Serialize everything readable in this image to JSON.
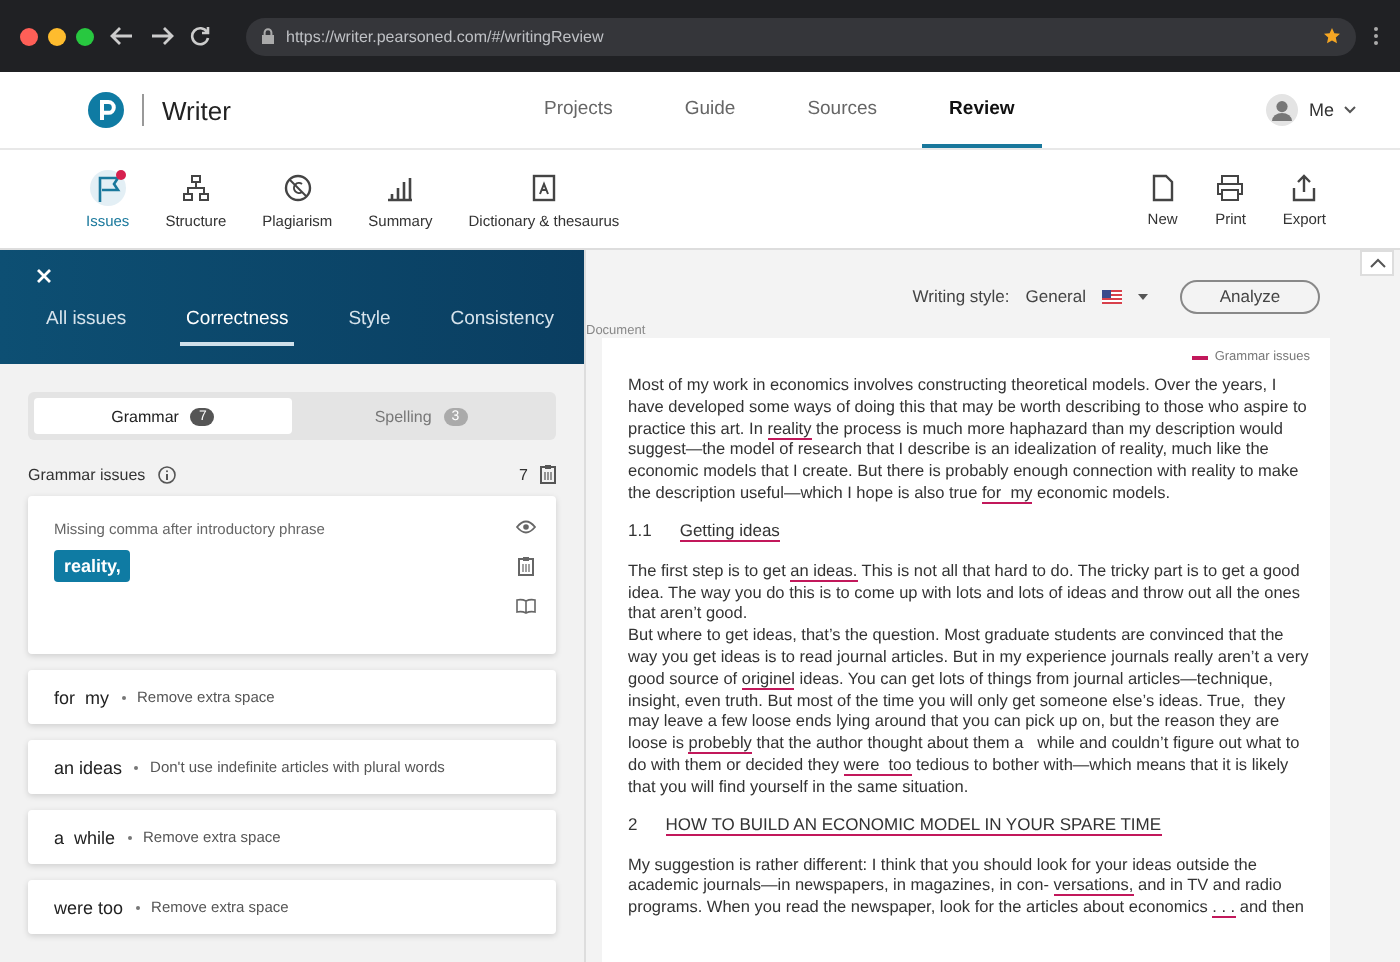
{
  "browser": {
    "url": "https://writer.pearsoned.com/#/writingReview"
  },
  "header": {
    "app_name": "Writer",
    "nav": [
      {
        "label": "Projects",
        "selected": false
      },
      {
        "label": "Guide",
        "selected": false
      },
      {
        "label": "Sources",
        "selected": false
      },
      {
        "label": "Review",
        "selected": true
      }
    ],
    "user": "Me"
  },
  "toolbar": {
    "tools": [
      {
        "label": "Issues",
        "kind": "flag",
        "selected": true,
        "alert": true
      },
      {
        "label": "Structure",
        "kind": "tree",
        "selected": false,
        "alert": false
      },
      {
        "label": "Plagiarism",
        "kind": "copyright",
        "selected": false,
        "alert": false
      },
      {
        "label": "Summary",
        "kind": "bars",
        "selected": false,
        "alert": false
      },
      {
        "label": "Dictionary & thesaurus",
        "kind": "dictionary",
        "selected": false,
        "alert": false
      }
    ],
    "actions": [
      {
        "label": "New",
        "kind": "page"
      },
      {
        "label": "Print",
        "kind": "printer"
      },
      {
        "label": "Export",
        "kind": "share"
      }
    ]
  },
  "issues_panel": {
    "tabs": [
      {
        "label": "All issues",
        "selected": false
      },
      {
        "label": "Correctness",
        "selected": true
      },
      {
        "label": "Style",
        "selected": false
      },
      {
        "label": "Consistency",
        "selected": false
      }
    ],
    "categories": [
      {
        "label": "Grammar",
        "count": "7",
        "selected": true
      },
      {
        "label": "Spelling",
        "count": "3",
        "selected": false
      }
    ],
    "section_title": "Grammar issues",
    "section_count": "7",
    "issues": [
      {
        "expanded": true,
        "message": "Missing comma after introductory phrase",
        "suggestion": "reality,"
      },
      {
        "expanded": false,
        "phrase": "for  my",
        "message": "Remove extra space"
      },
      {
        "expanded": false,
        "phrase": "an ideas",
        "message": "Don't use indefinite articles with plural words"
      },
      {
        "expanded": false,
        "phrase": "a  while",
        "message": "Remove extra space"
      },
      {
        "expanded": false,
        "phrase": "were too",
        "message": "Remove extra space"
      }
    ]
  },
  "document_pane": {
    "writing_style_label": "Writing style:",
    "writing_style": "General",
    "analyze_button": "Analyze",
    "section_label": "Document",
    "legend": "Grammar issues",
    "blocks": [
      {
        "kind": "paragraph",
        "segments": [
          {
            "text": "Most of my work in economics involves constructing theoretical models. Over the years, I have developed some ways of doing this that may be worth describing to those who aspire to practice this art. In ",
            "issue": false
          },
          {
            "text": "reality",
            "issue": true
          },
          {
            "text": " the process is much more haphazard than my description would suggest—the model of research that I describe is an idealization of reality, much like the economic models that I create. But there is probably enough connection with reality to make the description useful—which I hope is also true ",
            "issue": false
          },
          {
            "text": "for  my",
            "issue": true
          },
          {
            "text": " economic models.",
            "issue": false
          }
        ]
      },
      {
        "kind": "heading",
        "number": "1.1",
        "segments": [
          {
            "text": "Getting ideas",
            "issue": true
          }
        ]
      },
      {
        "kind": "paragraph",
        "segments": [
          {
            "text": "The first step is to get ",
            "issue": false
          },
          {
            "text": "an ideas.",
            "issue": true
          },
          {
            "text": " This is not all that hard to do. The tricky part is to get a good idea. The way you do this is to come up with lots and lots of ideas and throw out all the ones that aren’t good.",
            "issue": false
          }
        ]
      },
      {
        "kind": "paragraph",
        "segments": [
          {
            "text": "But where to get ideas, that’s the question. Most graduate students are convinced that the way you get ideas is to read journal articles. But in my experience journals really aren’t a very good source of ",
            "issue": false
          },
          {
            "text": "originel",
            "issue": true
          },
          {
            "text": " ideas. You can get lots of things from journal articles—technique, insight, even truth. But most of the time you will only get someone else’s ideas. True,  they  may leave a few loose ends lying around that you can pick up on, but the reason they are loose is ",
            "issue": false
          },
          {
            "text": "probebly",
            "issue": true
          },
          {
            "text": " that the author thought about them a   while and couldn’t figure out what to do with them or decided they ",
            "issue": false
          },
          {
            "text": "were  too",
            "issue": true
          },
          {
            "text": " tedious to bother with—which means that it is likely that you will find yourself in the same situation.",
            "issue": false
          }
        ]
      },
      {
        "kind": "heading",
        "number": "2",
        "segments": [
          {
            "text": "HOW TO BUILD AN ECONOMIC MODEL IN YOUR SPARE TIME",
            "issue": true
          }
        ]
      },
      {
        "kind": "paragraph",
        "segments": [
          {
            "text": "My suggestion is rather different: I think that you should look for your ideas outside the academic journals—in newspapers, in magazines, in con- ",
            "issue": false
          },
          {
            "text": "versations,",
            "issue": true
          },
          {
            "text": " and in TV and radio programs. When you read the newspaper, look for the articles about economics ",
            "issue": false
          },
          {
            "text": ". . .",
            "issue": true
          },
          {
            "text": " and then",
            "issue": false
          }
        ]
      }
    ]
  }
}
